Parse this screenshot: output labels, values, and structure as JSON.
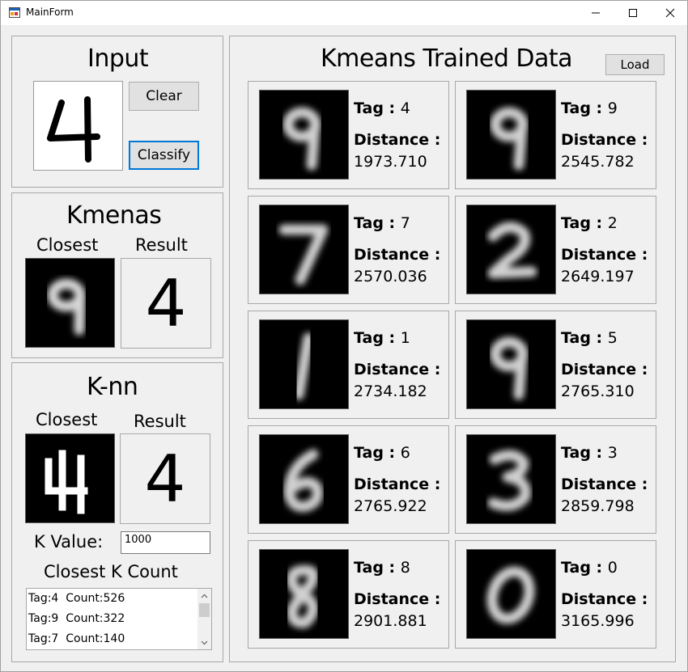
{
  "window": {
    "title": "MainForm"
  },
  "input": {
    "heading": "Input",
    "clear_label": "Clear",
    "classify_label": "Classify",
    "drawn_digit": "4"
  },
  "kmeans_panel": {
    "heading": "Kmenas",
    "closest_label": "Closest",
    "result_label": "Result",
    "closest_digit": "9",
    "result_value": "4"
  },
  "knn_panel": {
    "heading": "K-nn",
    "closest_label": "Closest",
    "result_label": "Result",
    "closest_digit": "4",
    "result_value": "4",
    "k_value_label": "K Value:",
    "k_value": "1000",
    "count_heading": "Closest K Count",
    "counts": [
      {
        "tag": "Tag:4",
        "count": "Count:526"
      },
      {
        "tag": "Tag:9",
        "count": "Count:322"
      },
      {
        "tag": "Tag:7",
        "count": "Count:140"
      }
    ]
  },
  "trained": {
    "heading": "Kmeans Trained Data",
    "load_label": "Load",
    "tag_label": "Tag",
    "distance_label": "Distance :",
    "items": [
      {
        "tag": "4",
        "distance": "1973.710",
        "digit": "9"
      },
      {
        "tag": "9",
        "distance": "2545.782",
        "digit": "9"
      },
      {
        "tag": "7",
        "distance": "2570.036",
        "digit": "7"
      },
      {
        "tag": "2",
        "distance": "2649.197",
        "digit": "2"
      },
      {
        "tag": "1",
        "distance": "2734.182",
        "digit": "1"
      },
      {
        "tag": "5",
        "distance": "2765.310",
        "digit": "9"
      },
      {
        "tag": "6",
        "distance": "2765.922",
        "digit": "6"
      },
      {
        "tag": "3",
        "distance": "2859.798",
        "digit": "3"
      },
      {
        "tag": "8",
        "distance": "2901.881",
        "digit": "8"
      },
      {
        "tag": "0",
        "distance": "3165.996",
        "digit": "0"
      }
    ]
  },
  "colors": {
    "accent": "#0078d7",
    "background": "#f0f0f0",
    "image_background": "#000000"
  }
}
